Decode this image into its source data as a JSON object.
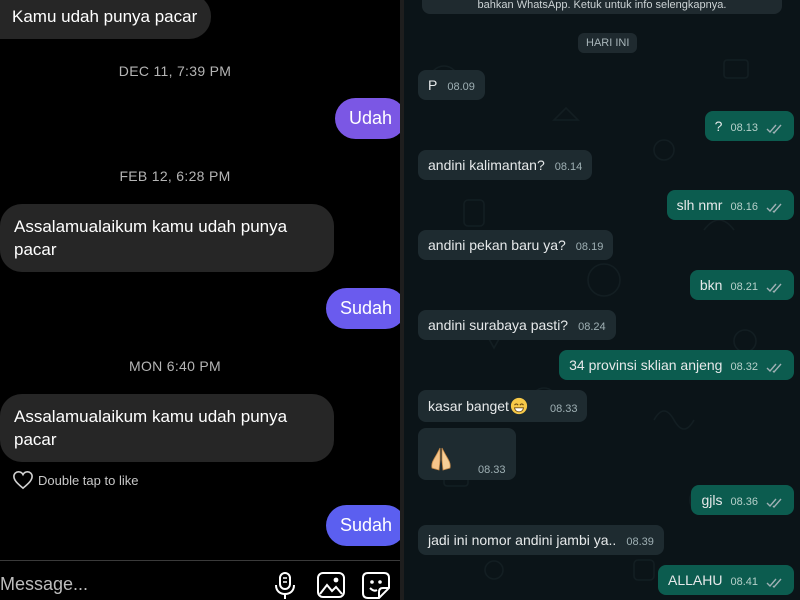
{
  "instagram": {
    "top_message": "Kamu udah punya pacar",
    "timestamps": [
      "DEC 11, 7:39 PM",
      "FEB 12, 6:28 PM",
      "MON 6:40 PM"
    ],
    "out_1": "Udah",
    "in_2": "Assalamualaikum kamu udah punya pacar",
    "out_2": "Sudah",
    "in_3": "Assalamualaikum kamu udah punya pacar",
    "double_tap": "Double tap to like",
    "out_3": "Sudah",
    "input_placeholder": "Message...",
    "colors": {
      "outgoing_purple": "#7b57e4",
      "outgoing_blue": "#5b5ff0",
      "incoming": "#262626"
    }
  },
  "whatsapp": {
    "banner": "bahkan WhatsApp. Ketuk untuk info selengkapnya.",
    "date_chip": "HARI INI",
    "messages": [
      {
        "dir": "in",
        "text": "P",
        "time": "08.09"
      },
      {
        "dir": "out",
        "text": "?",
        "time": "08.13"
      },
      {
        "dir": "in",
        "text": "andini kalimantan?",
        "time": "08.14"
      },
      {
        "dir": "out",
        "text": "slh nmr",
        "time": "08.16"
      },
      {
        "dir": "in",
        "text": "andini pekan baru ya?",
        "time": "08.19"
      },
      {
        "dir": "out",
        "text": "bkn",
        "time": "08.21"
      },
      {
        "dir": "in",
        "text": "andini surabaya pasti?",
        "time": "08.24"
      },
      {
        "dir": "out",
        "text": "34 provinsi sklian anjeng",
        "time": "08.32"
      },
      {
        "dir": "in",
        "text": "kasar banget",
        "time": "08.33"
      },
      {
        "dir": "in",
        "text": "",
        "time": "08.33"
      },
      {
        "dir": "out",
        "text": "gjls",
        "time": "08.36"
      },
      {
        "dir": "in",
        "text": "jadi ini nomor andini jambi ya..",
        "time": "08.39"
      },
      {
        "dir": "out",
        "text": "ALLAHU",
        "time": "08.41"
      }
    ],
    "colors": {
      "background": "#0b1418",
      "incoming": "#1e2b30",
      "outgoing": "#0c5c4f",
      "tick": "#9fb0b4"
    }
  }
}
